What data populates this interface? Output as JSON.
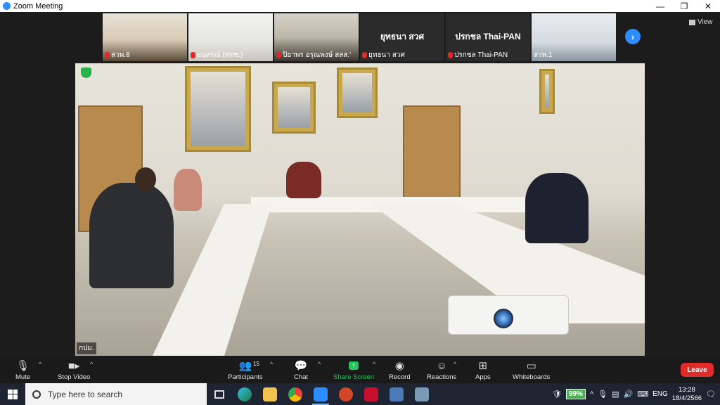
{
  "window": {
    "title": "Zoom Meeting",
    "minimize": "—",
    "restore": "❐",
    "close": "✕"
  },
  "gallery": {
    "tiles": [
      {
        "name": "สวพ.8",
        "muted": true
      },
      {
        "name": "อนุสรณ์ (สทช.)",
        "muted": true
      },
      {
        "name": "ปิยาพร อรุณพงษ์ สสส.'",
        "muted": true
      },
      {
        "name": "ยุทธนา สวศ",
        "display_name": "ยุทธนา สวศ",
        "muted": true
      },
      {
        "name": "ปรกชล Thai-PAN",
        "display_name": "ปรกชล Thai-PAN",
        "muted": true
      },
      {
        "name": "สวพ.1",
        "muted": false
      }
    ],
    "next_icon": "›"
  },
  "view": {
    "label": "View"
  },
  "main_video": {
    "name": "กปม."
  },
  "toolbar": {
    "mute": "Mute",
    "stop_video": "Stop Video",
    "participants": "Participants",
    "participants_count": "15",
    "chat": "Chat",
    "share_screen": "Share Screen",
    "share_icon": "↑",
    "record": "Record",
    "reactions": "Reactions",
    "apps": "Apps",
    "whiteboards": "Whiteboards",
    "leave": "Leave"
  },
  "taskbar": {
    "search_placeholder": "Type here to search",
    "battery": "99%",
    "language": "ENG",
    "time": "13:28",
    "date": "18/4/2566"
  },
  "colors": {
    "accent": "#2d8cff",
    "share": "#22c55e",
    "leave": "#e02b2b"
  }
}
